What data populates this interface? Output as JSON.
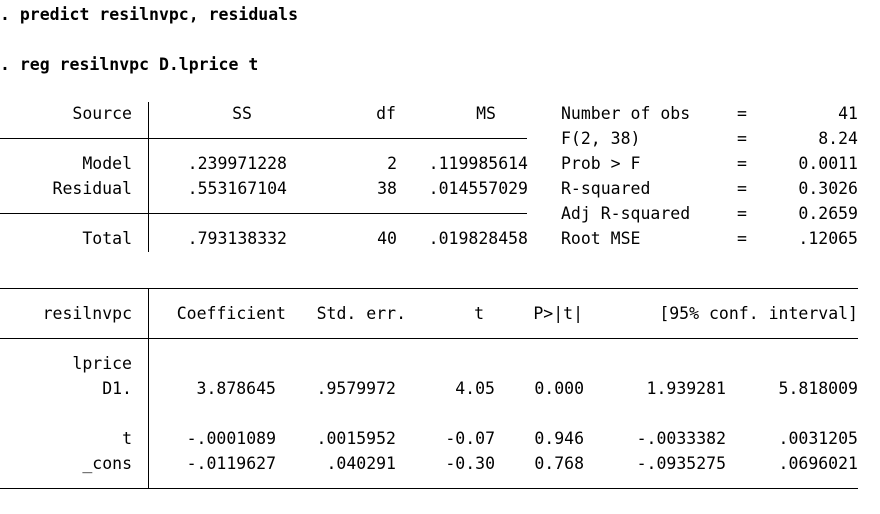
{
  "commands": {
    "line1": ". predict resilnvpc, residuals",
    "line2": ". reg resilnvpc D.lprice t"
  },
  "anova": {
    "headers": {
      "source": "Source",
      "ss": "SS",
      "df": "df",
      "ms": "MS"
    },
    "rows": [
      {
        "source": "Model",
        "ss": ".239971228",
        "df": "2",
        "ms": ".119985614"
      },
      {
        "source": "Residual",
        "ss": ".553167104",
        "df": "38",
        "ms": ".014557029"
      },
      {
        "source": "Total",
        "ss": ".793138332",
        "df": "40",
        "ms": ".019828458"
      }
    ]
  },
  "fit_stats": [
    {
      "label": "Number of obs",
      "eq": "=",
      "value": "41"
    },
    {
      "label": "F(2, 38)",
      "eq": "=",
      "value": "8.24"
    },
    {
      "label": "Prob > F",
      "eq": "=",
      "value": "0.0011"
    },
    {
      "label": "R-squared",
      "eq": "=",
      "value": "0.3026"
    },
    {
      "label": "Adj R-squared",
      "eq": "=",
      "value": "0.2659"
    },
    {
      "label": "Root MSE",
      "eq": "=",
      "value": ".12065"
    }
  ],
  "coef": {
    "headers": {
      "depvar": "resilnvpc",
      "coef": "Coefficient",
      "se": "Std. err.",
      "t": "t",
      "p": "P>|t|",
      "ci": "[95% conf. interval]"
    },
    "group_label": "lprice",
    "rows": [
      {
        "name": "D1.",
        "coef": "3.878645",
        "se": ".9579972",
        "t": "4.05",
        "p": "0.000",
        "lo": "1.939281",
        "hi": "5.818009"
      },
      {
        "name": "t",
        "coef": "-.0001089",
        "se": ".0015952",
        "t": "-0.07",
        "p": "0.946",
        "lo": "-.0033382",
        "hi": ".0031205"
      },
      {
        "name": "_cons",
        "coef": "-.0119627",
        "se": ".040291",
        "t": "-0.30",
        "p": "0.768",
        "lo": "-.0935275",
        "hi": ".0696021"
      }
    ]
  }
}
